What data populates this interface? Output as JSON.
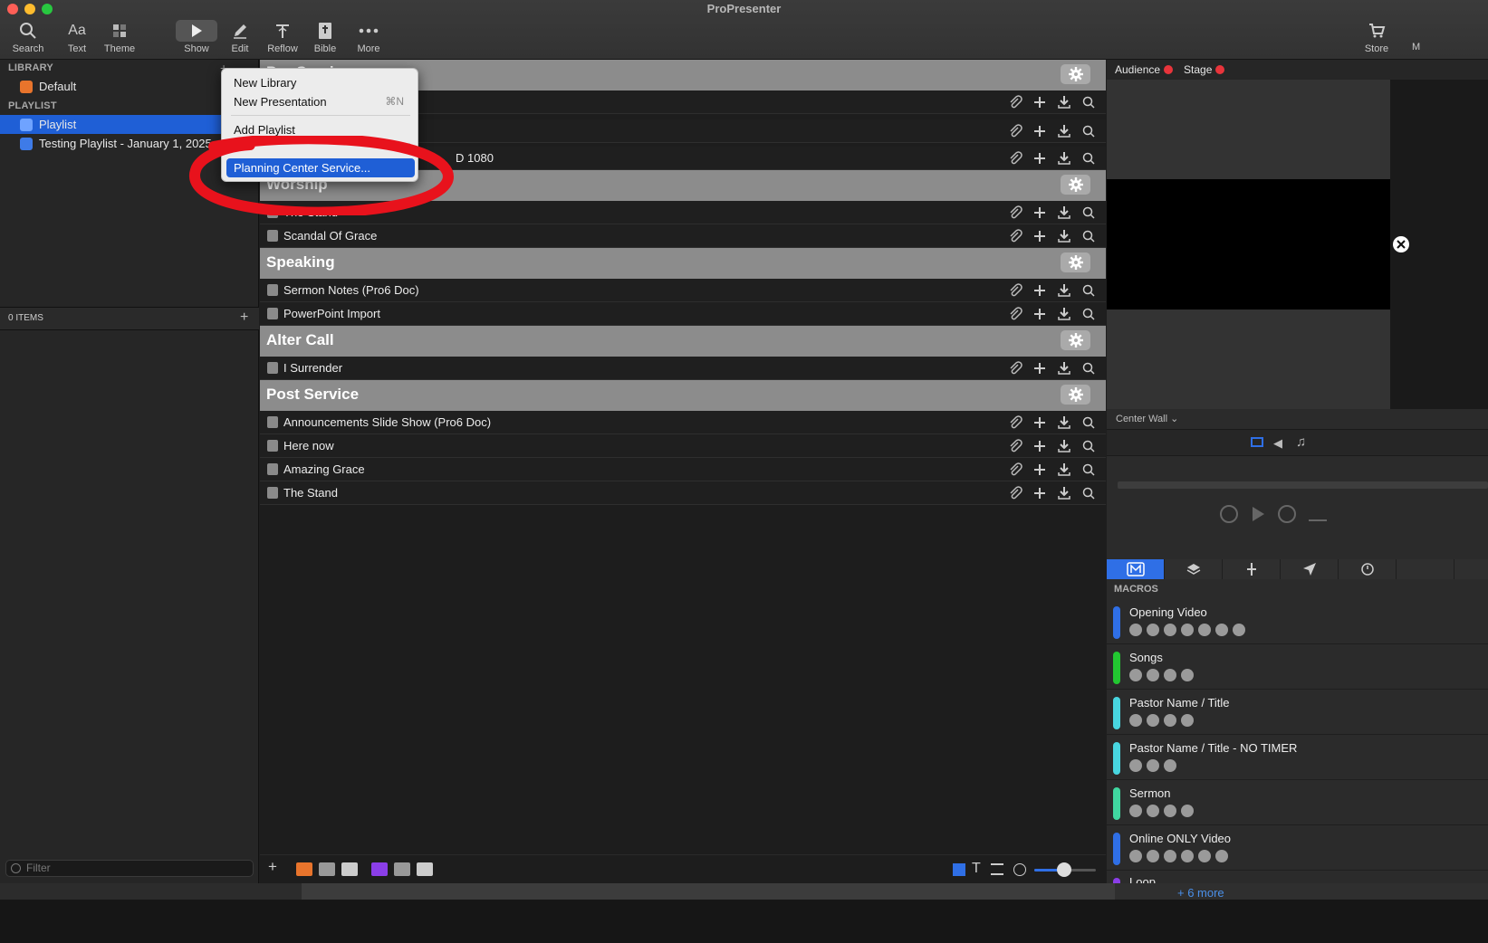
{
  "window": {
    "title": "ProPresenter"
  },
  "toolbar": {
    "search": "Search",
    "text": "Text",
    "theme": "Theme",
    "show": "Show",
    "edit": "Edit",
    "reflow": "Reflow",
    "bible": "Bible",
    "more": "More",
    "store": "Store",
    "edge": "M"
  },
  "sidebar": {
    "library_header": "LIBRARY",
    "library_item": "Default",
    "playlist_header": "PLAYLIST",
    "playlists": [
      "Playlist",
      "Testing Playlist - January 1, 2025"
    ],
    "items_count": "0 ITEMS",
    "filter_placeholder": "Filter"
  },
  "context_menu": {
    "new_library": "New Library",
    "new_presentation": "New Presentation",
    "new_presentation_shortcut": "⌘N",
    "add_playlist": "Add Playlist",
    "planning_center": "Planning Center Service..."
  },
  "main": {
    "partial_group": "Pre-Service",
    "hidden_item_suffix": "D 1080",
    "worship_partial_item": "The Stand",
    "groups": [
      {
        "title": "Worship",
        "items": [
          "The Stand",
          "Scandal Of Grace"
        ]
      },
      {
        "title": "Speaking",
        "items": [
          "Sermon Notes (Pro6 Doc)",
          "PowerPoint Import"
        ]
      },
      {
        "title": "Alter Call",
        "items": [
          "I Surrender"
        ]
      },
      {
        "title": "Post Service",
        "items": [
          "Announcements Slide Show (Pro6 Doc)",
          "Here now",
          "Amazing Grace",
          "The Stand"
        ]
      }
    ]
  },
  "right_panel": {
    "audience": "Audience",
    "stage": "Stage",
    "screen_selector": "Center Wall",
    "macros_header": "MACROS",
    "macros": [
      {
        "name": "Opening Video",
        "color": "#2f6fe6",
        "icons": 7
      },
      {
        "name": "Songs",
        "color": "#22c731",
        "icons": 4
      },
      {
        "name": "Pastor Name / Title",
        "color": "#48d6e0",
        "icons": 4
      },
      {
        "name": "Pastor Name / Title - NO TIMER",
        "color": "#48d6e0",
        "icons": 3
      },
      {
        "name": "Sermon",
        "color": "#40d7a0",
        "icons": 4
      },
      {
        "name": "Online ONLY Video",
        "color": "#2f6fe6",
        "icons": 6
      }
    ],
    "macro_partial": "Loop",
    "more_link": "+ 6 more"
  },
  "colors": {
    "accent": "#2f6fe6",
    "annotation": "#e8121c",
    "live_dot": "#e8343b"
  }
}
